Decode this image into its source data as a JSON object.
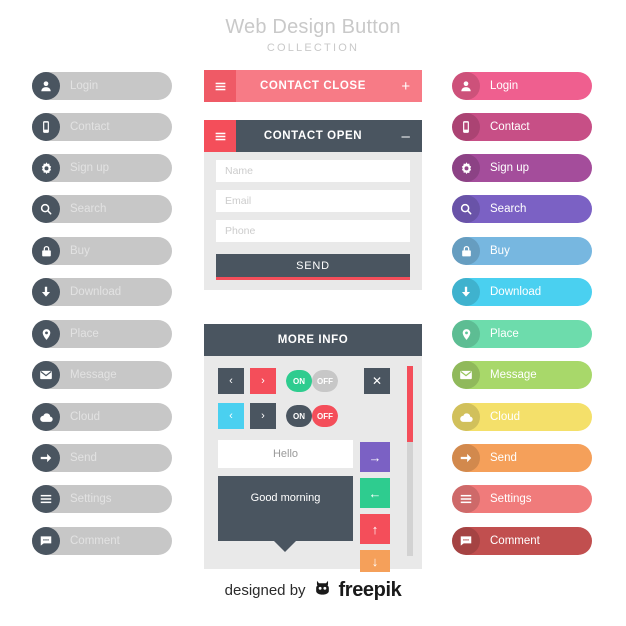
{
  "header": {
    "title": "Web Design Button",
    "subtitle": "COLLECTION"
  },
  "left_column": {
    "items": [
      {
        "label": "Login",
        "icon": "user-icon"
      },
      {
        "label": "Contact",
        "icon": "phone-icon"
      },
      {
        "label": "Sign up",
        "icon": "gear-icon"
      },
      {
        "label": "Search",
        "icon": "search-icon"
      },
      {
        "label": "Buy",
        "icon": "lock-icon"
      },
      {
        "label": "Download",
        "icon": "download-arrow-icon"
      },
      {
        "label": "Place",
        "icon": "map-pin-icon"
      },
      {
        "label": "Message",
        "icon": "envelope-icon"
      },
      {
        "label": "Cloud",
        "icon": "cloud-icon"
      },
      {
        "label": "Send",
        "icon": "arrow-right-icon"
      },
      {
        "label": "Settings",
        "icon": "list-icon"
      },
      {
        "label": "Comment",
        "icon": "chat-bubble-icon"
      }
    ],
    "background": "#c7c7c7",
    "icon_background": "#4a5560"
  },
  "right_column": {
    "items": [
      {
        "label": "Login",
        "icon": "user-icon",
        "color": "#ef5f8f"
      },
      {
        "label": "Contact",
        "icon": "phone-icon",
        "color": "#c74f86"
      },
      {
        "label": "Sign up",
        "icon": "gear-icon",
        "color": "#a44d9b"
      },
      {
        "label": "Search",
        "icon": "search-icon",
        "color": "#7b61c4"
      },
      {
        "label": "Buy",
        "icon": "lock-icon",
        "color": "#77b7e0"
      },
      {
        "label": "Download",
        "icon": "download-arrow-icon",
        "color": "#4ad0f0"
      },
      {
        "label": "Place",
        "icon": "map-pin-icon",
        "color": "#6ddcac"
      },
      {
        "label": "Message",
        "icon": "envelope-icon",
        "color": "#a8d86a"
      },
      {
        "label": "Cloud",
        "icon": "cloud-icon",
        "color": "#f4e06a"
      },
      {
        "label": "Send",
        "icon": "arrow-right-icon",
        "color": "#f5a05a"
      },
      {
        "label": "Settings",
        "icon": "list-icon",
        "color": "#f07b7b"
      },
      {
        "label": "Comment",
        "icon": "chat-bubble-icon",
        "color": "#c14f4f"
      }
    ]
  },
  "contact_close": {
    "title": "CONTACT CLOSE",
    "expand_symbol": "+",
    "bar_color": "#f77b86",
    "burger_color": "#ef5a66"
  },
  "contact_open": {
    "title": "CONTACT OPEN",
    "collapse_symbol": "–",
    "bar_color": "#4a5560",
    "burger_color": "#f44e5a",
    "fields": [
      {
        "placeholder": "Name"
      },
      {
        "placeholder": "Email"
      },
      {
        "placeholder": "Phone"
      }
    ],
    "send_label": "SEND",
    "send_accent": "#f44e5a"
  },
  "more_info": {
    "title": "MORE INFO",
    "bar_color": "#4a5560",
    "nav_row_1": {
      "prev": "‹",
      "next": "›",
      "prev_color": "#4a5560",
      "next_color": "#f44e5a"
    },
    "nav_row_2": {
      "prev": "‹",
      "next": "›",
      "prev_color": "#4ad0f0",
      "next_color": "#4a5560"
    },
    "toggle_1": {
      "on_label": "ON",
      "off_label": "OFF",
      "state": "on",
      "on_color": "#2ecc8f",
      "off_color": "#c7c7c7"
    },
    "toggle_2": {
      "on_label": "ON",
      "off_label": "OFF",
      "state": "off",
      "on_color": "#4a5560",
      "off_color": "#f44e5a"
    },
    "close_button": {
      "symbol": "✕",
      "color": "#4a5560"
    },
    "hello_text": "Hello",
    "bubble_text": "Good morning",
    "arrow_buttons": [
      {
        "icon": "arrow-right-icon",
        "symbol": "→",
        "color": "#7b61c4"
      },
      {
        "icon": "arrow-left-icon",
        "symbol": "←",
        "color": "#2ecc8f"
      },
      {
        "icon": "arrow-up-icon",
        "symbol": "↑",
        "color": "#f44e5a"
      },
      {
        "icon": "arrow-down-icon",
        "symbol": "↓",
        "color": "#f5a05a"
      }
    ],
    "scrollbar": {
      "track_color": "#d2d2d2",
      "thumb_color": "#f44e5a"
    }
  },
  "footer": {
    "designed_by": "designed by",
    "brand": "freepik",
    "logo": "freepik-robot-icon"
  }
}
